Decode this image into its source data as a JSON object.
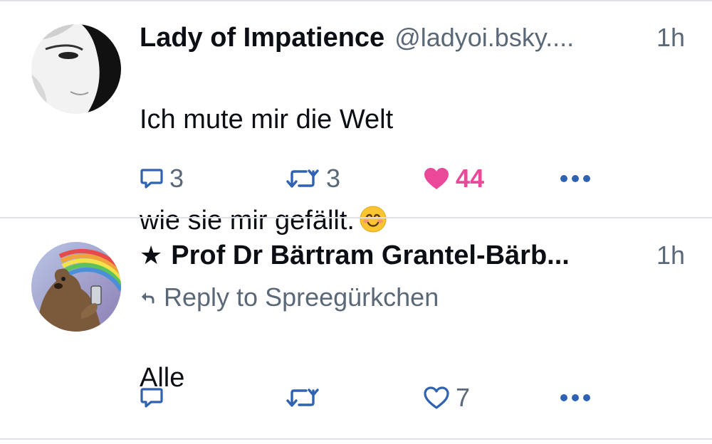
{
  "posts": [
    {
      "author": "Lady of Impatience",
      "handle": "@ladyoi.bsky....",
      "time": "1h",
      "line1": "Ich mute mir die Welt",
      "line2": "wie sie mir gefällt.",
      "emoji": "smiling-face-with-smiling-eyes",
      "reply_count": "3",
      "repost_count": "3",
      "like_count": "44",
      "liked": true
    },
    {
      "star": "★",
      "author": "Prof Dr Bärtram Grantel-Bärb...",
      "time": "1h",
      "reply_to_label": "Reply to Spreegürkchen",
      "text": "Alle",
      "reply_count": "",
      "repost_count": "",
      "like_count": "7",
      "liked": false
    }
  ],
  "colors": {
    "accent": "#2f62b0",
    "like": "#ec4899",
    "muted": "#5a6878",
    "divider": "#dfe3e8"
  }
}
